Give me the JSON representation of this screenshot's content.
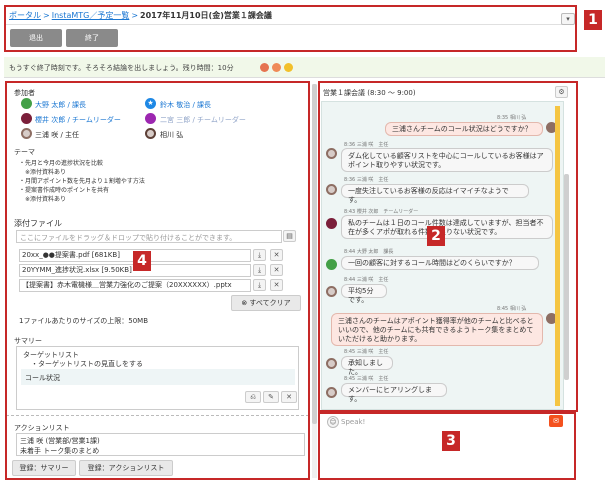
{
  "header": {
    "breadcrumb": [
      "ポータル",
      "InstaMTG／予定一覧",
      "2017年11月10日(金)営業１課会議"
    ],
    "menu_icon": "chevron-down-icon"
  },
  "toolbar": {
    "exit_label": "退出",
    "end_label": "終了"
  },
  "notice": {
    "text": "もうすぐ終了時刻です。そろそろ結論を出しましょう。残り時間：10分",
    "dots": [
      "#e57350",
      "#ef8a57",
      "#f2c02a"
    ]
  },
  "participants": {
    "title": "参加者",
    "items": [
      {
        "name": "大野 太郎 / 課長",
        "color": "#43a047",
        "link": true
      },
      {
        "name": "鈴木 敬治 / 課長",
        "color": "#1e88e5",
        "link": true,
        "icon": "star-icon"
      },
      {
        "name": "櫻井 次郎 / チームリーダー",
        "color": "#7b1f3a",
        "link": true
      },
      {
        "name": "二宮 三郎 / チームリーダー",
        "color": "#9c27b0",
        "link": true,
        "faded": true
      },
      {
        "name": "三浦 咲 / 主任",
        "color": "#8d6e63",
        "link": false
      },
      {
        "name": "相川 弘",
        "color": "#5d4037",
        "link": false
      }
    ]
  },
  "theme": {
    "title": "テーマ",
    "lines": [
      "・先月と今月の進捗状況を比較",
      "　※添付資料あり",
      "・月間アポイント数を先月より１割増やす方法",
      "・提案書作成時のポイントを共有",
      "　※添付資料あり"
    ]
  },
  "files": {
    "title": "添付ファイル",
    "drop_placeholder": "ここにファイルをドラッグ＆ドロップで貼り付けることができます。",
    "items": [
      "20xx_●●提案書.pdf [681KB]",
      "20YYMM_進捗状況.xlsx [9.50KB]",
      "【提案書】赤木電機様＿営業力強化のご提案（20XXXXXX）.pptx"
    ],
    "clear_all": "すべてクリア",
    "size_limit": "1ファイルあたりのサイズの上限：50MB"
  },
  "summary": {
    "title": "サマリー",
    "content_lines": [
      "ターゲットリスト",
      "・ターゲットリストの見直しをする"
    ],
    "sub_block": "コール状況"
  },
  "actions": {
    "title": "アクションリスト",
    "lines": [
      "三浦 咲 (営業部/営業1課)",
      "未着手 トーク集のまとめ"
    ],
    "save_summary": "登録：サマリー",
    "save_actions": "登録：アクションリスト"
  },
  "chat": {
    "title": "営業１課会議 (8:30 〜 9:00)",
    "input_placeholder": "Speak!",
    "messages": [
      {
        "side": "right",
        "time": "8:35",
        "name": "相川 弘",
        "text": "三浦さんチームのコール状況はどうですか？"
      },
      {
        "side": "left",
        "time": "8:36",
        "name": "三浦 咲　主任",
        "text": "ダム化している顧客リストを中心にコールしているお客様はアポイント取りやすい状況です。"
      },
      {
        "side": "left",
        "time": "8:36",
        "name": "三浦 咲　主任",
        "text": "一度失注しているお客様の反応はイマイチなようです。"
      },
      {
        "side": "left",
        "time": "8:43",
        "name": "櫻井 次郎　チームリーダー",
        "text": "私のチームは１日のコール件数は達成していますが、担当者不在が多くアポが取れる件数が足りない状況です。"
      },
      {
        "side": "left",
        "time": "8:44",
        "name": "大野 太郎　課長",
        "text": "一回の顧客に対するコール時間はどのくらいですか？"
      },
      {
        "side": "left",
        "time": "8:44",
        "name": "三浦 咲　主任",
        "text": "平均5分です。"
      },
      {
        "side": "right",
        "time": "8:45",
        "name": "相川 弘",
        "text": "三浦さんのチームはアポイント獲得率が他のチームと比べるといいので、他のチームにも共有できるようトーク集をまとめていただけると助かります。"
      },
      {
        "side": "left",
        "time": "8:45",
        "name": "三浦 咲　主任",
        "text": "承知しました。"
      },
      {
        "side": "left",
        "time": "8:45",
        "name": "三浦 咲　主任",
        "text": "メンバーにヒアリングします。"
      }
    ]
  },
  "callouts": [
    "1",
    "2",
    "3",
    "4"
  ]
}
